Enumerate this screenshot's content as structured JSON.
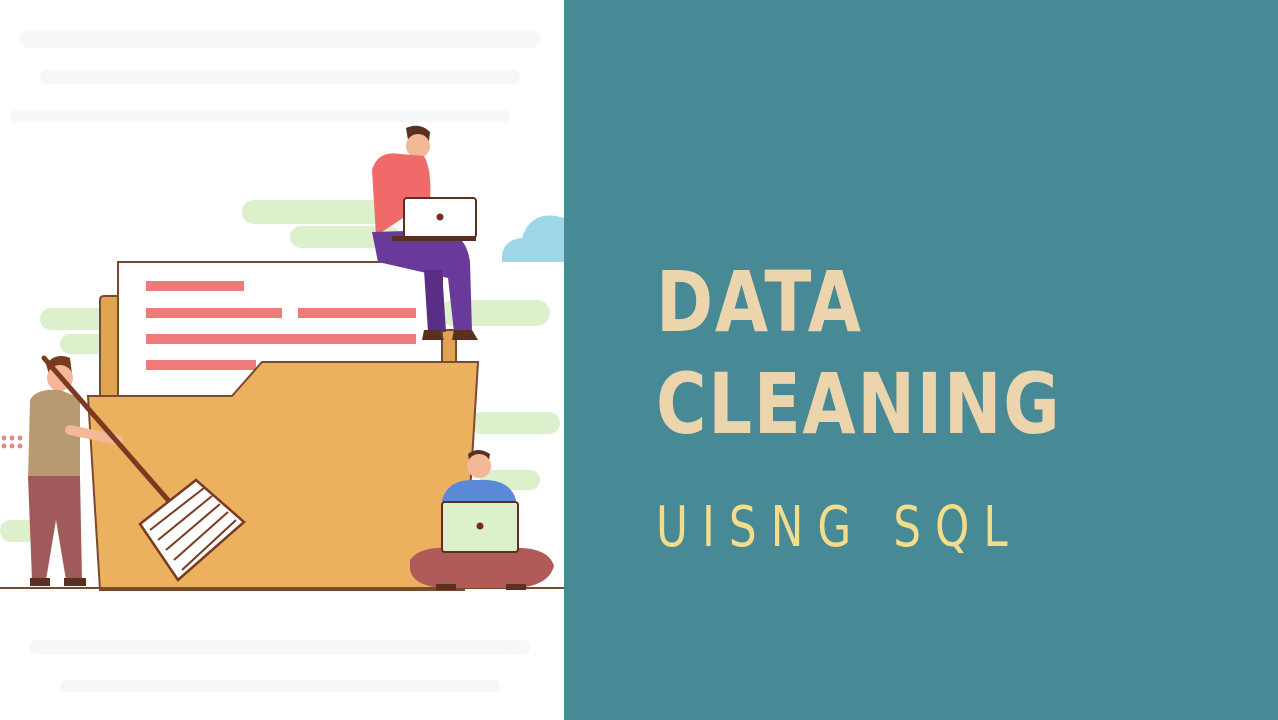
{
  "title": {
    "line1": "DATA",
    "line2": "CLEANING"
  },
  "subtitle": "UISNG SQL",
  "colors": {
    "panel_background": "#478a96",
    "title_text": "#ecd4ad",
    "subtitle_text": "#f3dc8a",
    "folder": "#ecb15e",
    "document_lines": "#f07a7a"
  },
  "illustration": {
    "description_icons": [
      "folder-icon",
      "document-icon",
      "laptop-icon",
      "broom-icon",
      "person-icon",
      "cloud-icon"
    ]
  }
}
